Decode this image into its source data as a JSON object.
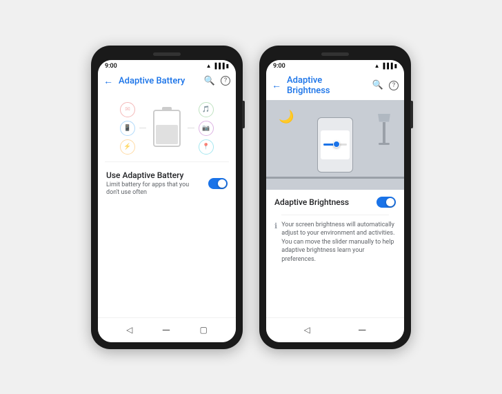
{
  "background": "#f0f0f0",
  "phone_left": {
    "status_time": "9:00",
    "app_bar_title": "Adaptive Battery",
    "back_arrow": "←",
    "search_icon": "🔍",
    "help_icon": "?",
    "battery_illustration_alt": "Battery with app icons",
    "setting_title": "Use Adaptive Battery",
    "setting_subtitle": "Limit battery for apps that you don't use often",
    "toggle_on": true,
    "app_colors": [
      "#ef9a9a",
      "#90caf9",
      "#a5d6a7",
      "#fff176",
      "#ce93d8",
      "#80deea"
    ],
    "nav_back": "◁",
    "nav_home": "—",
    "nav_recent": "▢"
  },
  "phone_right": {
    "status_time": "9:00",
    "app_bar_title": "Adaptive Brightness",
    "back_arrow": "←",
    "search_icon": "🔍",
    "help_icon": "?",
    "illustration_alt": "Room with phone showing brightness slider",
    "setting_title": "Adaptive Brightness",
    "setting_description": "Your screen brightness will automatically adjust to your environment and activities. You can move the slider manually to help adaptive brightness learn your preferences.",
    "toggle_on": true,
    "info_icon": "ℹ",
    "nav_back": "◁",
    "nav_home": "—"
  }
}
